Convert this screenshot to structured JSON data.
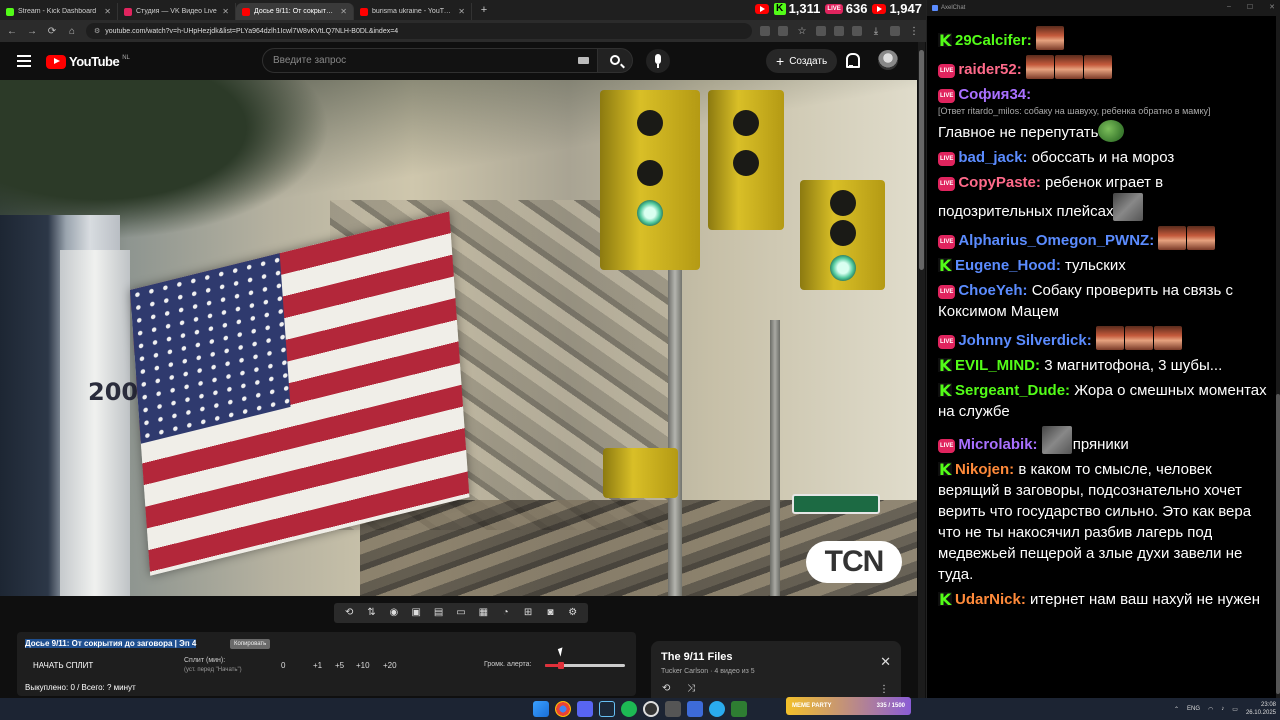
{
  "browser": {
    "tabs": [
      {
        "label": "Stream - Kick Dashboard",
        "color": "#53fc18"
      },
      {
        "label": "Студия — VK Видео Live",
        "color": "#e0245e"
      },
      {
        "label": "Досье 9/11: От сокрытия до за",
        "color": "#ff0000"
      },
      {
        "label": "burisma ukraine - YouTube",
        "color": "#ff0000"
      }
    ],
    "url": "youtube.com/watch?v=h-UHpHezjdk&list=PLYa964dzlh1Icwl7W8vKVtLQ7NLH-B0DL&index=4"
  },
  "stats": {
    "kick_viewers": "1,311",
    "vk_viewers": "636",
    "youtube_viewers": "1,947"
  },
  "youtube": {
    "logo_text": "YouTube",
    "region": "NL",
    "search_placeholder": "Введите запрос",
    "create_label": "Создать"
  },
  "video": {
    "truck_text": "2000RM0634",
    "watermark": "TCN"
  },
  "split_panel": {
    "title": "Досье 9/11: От сокрытия до заговора | Эп 4",
    "badge": "Копировать",
    "start_button": "НАЧАТЬ СПЛИТ",
    "split_label": "Сплит (мин):",
    "split_hint": "(уст. перед \"Начать\")",
    "current": "0",
    "increments": [
      "+1",
      "+5",
      "+10",
      "+20"
    ],
    "volume_label": "Громк. алерта:",
    "volume_level": 0.2,
    "bought": "Выкуплено: 0 / Всего: ? минут"
  },
  "playlist": {
    "title": "The 9/11 Files",
    "subtitle": "Tucker Carlson · 4 видео из 5"
  },
  "chat": {
    "window_title": "AxelChat",
    "messages": [
      {
        "platform": "kick",
        "nick": "29Calcifer:",
        "color": "#53fc18",
        "text": "",
        "emotes": 1
      },
      {
        "platform": "vk",
        "nick": "raider52:",
        "color": "#ff6a8a",
        "text": "",
        "emotes": 3
      },
      {
        "platform": "vk",
        "nick": "София34:",
        "color": "#a970ff",
        "reply": "[Ответ ritardo_milos: собаку на шавуху, ребенка обратно в мамку]",
        "text": "Главное не перепутать"
      },
      {
        "platform": "vk",
        "nick": "bad_jack:",
        "color": "#5b8cff",
        "text": "обоссать и на мороз"
      },
      {
        "platform": "vk",
        "nick": "CopyPaste:",
        "color": "#ff6a8a",
        "text": "ребенок играет в подозрительных плейсах"
      },
      {
        "platform": "vk",
        "nick": "Alpharius_Omegon_PWNZ:",
        "color": "#5b8cff",
        "text": "",
        "emotes": 2
      },
      {
        "platform": "kick",
        "nick": "Eugene_Hood:",
        "color": "#5b8cff",
        "text": "тульских"
      },
      {
        "platform": "vk",
        "nick": "ChoeYeh:",
        "color": "#5b8cff",
        "text": "Собаку проверить на связь с Коксимом Мацем"
      },
      {
        "platform": "vk",
        "nick": "Johnny Silverdick:",
        "color": "#5b8cff",
        "text": "",
        "emotes": 3
      },
      {
        "platform": "kick",
        "nick": "EVIL_MIND:",
        "color": "#53fc18",
        "text": "3 магнитофона, 3 шубы..."
      },
      {
        "platform": "kick",
        "nick": "Sergeant_Dude:",
        "color": "#53fc18",
        "text": "Жора о смешных моментах на службе"
      },
      {
        "platform": "vk",
        "nick": "Microlabik:",
        "color": "#a970ff",
        "text": "пряники"
      },
      {
        "platform": "kick",
        "nick": "Nikojen:",
        "color": "#ff8a3a",
        "text": "в каком то смысле, человек верящий в заговоры, подсознательно хочет верить что государство сильно. Это как вера что не ты накосячил разбив лагерь под медвежьей пещерой а злые духи завели не туда."
      },
      {
        "platform": "kick",
        "nick": "UdarNick:",
        "color": "#ff8a3a",
        "text": "итернет нам ваш нахуй не нужен"
      }
    ]
  },
  "taskbar": {
    "game_tag": "MEME PARTY",
    "game_counter": "335 / 1500",
    "lang": "ENG",
    "time": "23:08",
    "date": "26.10.2025"
  }
}
